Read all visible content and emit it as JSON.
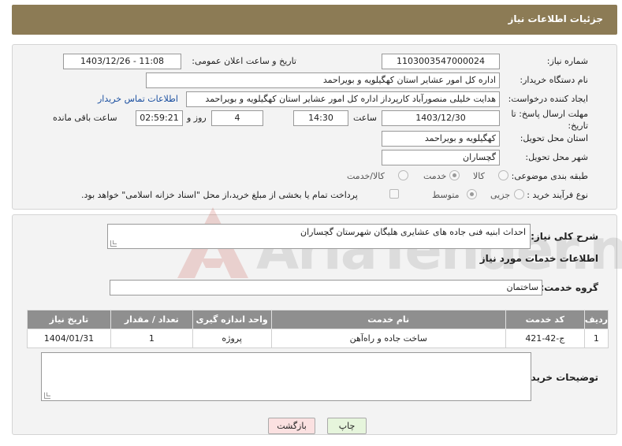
{
  "header": {
    "title": "جزئیات اطلاعات نیاز"
  },
  "form": {
    "need_number_label": "شماره نیاز:",
    "need_number": "1103003547000024",
    "announce_label": "تاریخ و ساعت اعلان عمومی:",
    "announce_value": "1403/12/26 - 11:08",
    "buyer_org_label": "نام دستگاه خریدار:",
    "buyer_org": "اداره کل امور عشایر استان کهگیلویه و بویراحمد",
    "requester_label": "ایجاد کننده درخواست:",
    "requester": "هدایت خلیلی منصورآباد کارپرداز اداره کل امور عشایر استان کهگیلویه و بویراحمد",
    "contact_link": "اطلاعات تماس خریدار",
    "deadline_label": "مهلت ارسال پاسخ: تا تاریخ:",
    "deadline_date": "1403/12/30",
    "hour_label": "ساعت",
    "deadline_time": "14:30",
    "days_value": "4",
    "day_and_label": "روز و",
    "remaining_time": "02:59:21",
    "remaining_label": "ساعت باقی مانده",
    "province_label": "استان محل تحویل:",
    "province": "کهگیلویه و بویراحمد",
    "city_label": "شهر محل تحویل:",
    "city": "گچساران",
    "category_label": "طبقه بندی موضوعی:",
    "category_options": [
      "کالا",
      "خدمت",
      "کالا/خدمت"
    ],
    "category_selected": "خدمت",
    "process_label": "نوع فرآیند خرید :",
    "process_options": [
      "جزیی",
      "متوسط"
    ],
    "process_selected": "متوسط",
    "payment_note": "پرداخت تمام یا بخشی از مبلغ خرید،از محل \"اسناد خزانه اسلامی\" خواهد بود."
  },
  "details": {
    "summary_label": "شرح کلی نیاز:",
    "summary": "احداث ابنیه فنی جاده های عشایری هلیگان شهرستان گچساران",
    "services_title": "اطلاعات خدمات مورد نیاز",
    "group_label": "گروه خدمت:",
    "group": "ساختمان",
    "table": {
      "headers": [
        "ردیف",
        "کد خدمت",
        "نام خدمت",
        "واحد اندازه گیری",
        "تعداد / مقدار",
        "تاریخ نیاز"
      ],
      "rows": [
        [
          "1",
          "ج-42-421",
          "ساخت جاده و راه‌آهن",
          "پروژه",
          "1",
          "1404/01/31"
        ]
      ]
    },
    "buyer_notes_label": "توضیحات خریدار:",
    "buyer_notes": ""
  },
  "buttons": {
    "print": "چاپ",
    "back": "بازگشت"
  },
  "watermark": {
    "text": "AriaTender.neT"
  },
  "colors": {
    "header": "#8c7b55",
    "table_header": "#8f8f8f",
    "link": "#1a4fa0",
    "watermark": "#c0392b"
  }
}
